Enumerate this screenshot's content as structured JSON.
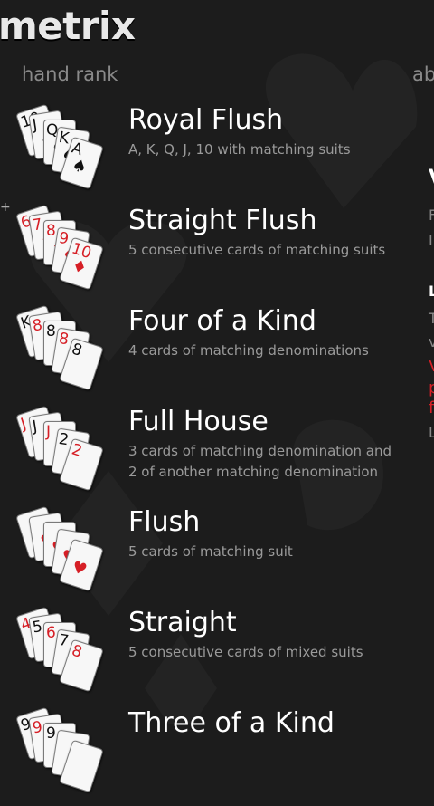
{
  "app": {
    "title": "metrix"
  },
  "pivot": {
    "active": "hand rank",
    "next": "abo"
  },
  "hands": [
    {
      "title": "Royal Flush",
      "desc": "A, K, Q, J, 10 with matching suits",
      "cards": [
        {
          "r": "10",
          "s": "♠",
          "c": "black"
        },
        {
          "r": "J",
          "s": "♠",
          "c": "black"
        },
        {
          "r": "Q",
          "s": "♠",
          "c": "black"
        },
        {
          "r": "K",
          "s": "♠",
          "c": "black"
        },
        {
          "r": "A",
          "s": "♠",
          "c": "black"
        }
      ]
    },
    {
      "title": "Straight Flush",
      "desc": "5 consecutive cards of matching suits",
      "cards": [
        {
          "r": "6",
          "s": "♦",
          "c": "red"
        },
        {
          "r": "7",
          "s": "♦",
          "c": "red"
        },
        {
          "r": "8",
          "s": "♦",
          "c": "red"
        },
        {
          "r": "9",
          "s": "♦",
          "c": "red"
        },
        {
          "r": "10",
          "s": "♦",
          "c": "red"
        }
      ]
    },
    {
      "title": "Four of a Kind",
      "desc": "4 cards of matching denominations",
      "cards": [
        {
          "r": "K",
          "s": "",
          "c": "black"
        },
        {
          "r": "8",
          "s": "",
          "c": "red"
        },
        {
          "r": "8",
          "s": "",
          "c": "black"
        },
        {
          "r": "8",
          "s": "",
          "c": "red"
        },
        {
          "r": "8",
          "s": "",
          "c": "black"
        }
      ]
    },
    {
      "title": "Full House",
      "desc": "3 cards of matching denomination and 2 of another matching denomination",
      "cards": [
        {
          "r": "J",
          "s": "",
          "c": "red"
        },
        {
          "r": "J",
          "s": "",
          "c": "black"
        },
        {
          "r": "J",
          "s": "",
          "c": "red"
        },
        {
          "r": "2",
          "s": "",
          "c": "black"
        },
        {
          "r": "2",
          "s": "",
          "c": "red"
        }
      ]
    },
    {
      "title": "Flush",
      "desc": "5 cards of matching suit",
      "cards": [
        {
          "r": "",
          "s": "♥",
          "c": "red"
        },
        {
          "r": "",
          "s": "♥",
          "c": "red"
        },
        {
          "r": "",
          "s": "♥",
          "c": "red"
        },
        {
          "r": "",
          "s": "♥",
          "c": "red"
        },
        {
          "r": "",
          "s": "♥",
          "c": "red"
        }
      ]
    },
    {
      "title": "Straight",
      "desc": "5 consecutive cards of mixed suits",
      "cards": [
        {
          "r": "4",
          "s": "",
          "c": "red"
        },
        {
          "r": "5",
          "s": "",
          "c": "black"
        },
        {
          "r": "6",
          "s": "",
          "c": "red"
        },
        {
          "r": "7",
          "s": "",
          "c": "black"
        },
        {
          "r": "8",
          "s": "",
          "c": "red"
        }
      ]
    },
    {
      "title": "Three of a Kind",
      "desc": "",
      "cards": [
        {
          "r": "9",
          "s": "",
          "c": "black"
        },
        {
          "r": "9",
          "s": "",
          "c": "red"
        },
        {
          "r": "9",
          "s": "",
          "c": "black"
        },
        {
          "r": "",
          "s": "",
          "c": "black"
        },
        {
          "r": "",
          "s": "",
          "c": "black"
        }
      ]
    }
  ],
  "edge_peek": {
    "texts": [
      {
        "t": "V",
        "c": "#fff"
      },
      {
        "t": "F",
        "c": "#888"
      },
      {
        "t": "I",
        "c": "#888"
      },
      {
        "t": "L",
        "c": "#fff"
      },
      {
        "t": "T",
        "c": "#888"
      },
      {
        "t": "v",
        "c": "#888"
      },
      {
        "t": "V",
        "c": "#d61f26"
      },
      {
        "t": "p",
        "c": "#d61f26"
      },
      {
        "t": "f",
        "c": "#d61f26"
      },
      {
        "t": "L",
        "c": "#888"
      }
    ]
  },
  "colors": {
    "background": "#1c1c1c",
    "accent_red": "#d61f26",
    "muted_text": "#9a9a9a"
  }
}
